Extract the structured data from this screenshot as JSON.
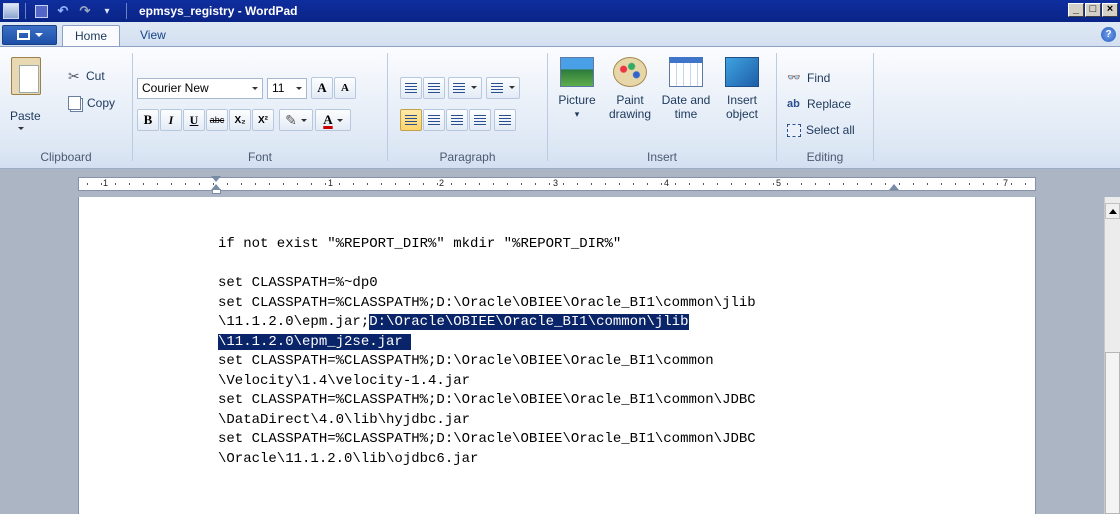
{
  "window": {
    "title": "epmsys_registry - WordPad"
  },
  "tabs": [
    {
      "label": "Home"
    },
    {
      "label": "View"
    }
  ],
  "ribbon": {
    "clipboard": {
      "group_label": "Clipboard",
      "paste": "Paste",
      "cut": "Cut",
      "copy": "Copy"
    },
    "font": {
      "group_label": "Font",
      "family": "Courier New",
      "size": "11",
      "grow": "A",
      "shrink": "A",
      "bold": "B",
      "italic": "I",
      "underline": "U",
      "strike": "abc",
      "subscript": "X₂",
      "superscript": "X²"
    },
    "paragraph": {
      "group_label": "Paragraph"
    },
    "insert": {
      "group_label": "Insert",
      "picture": "Picture",
      "paint_line1": "Paint",
      "paint_line2": "drawing",
      "datetime_line1": "Date and",
      "datetime_line2": "time",
      "object_line1": "Insert",
      "object_line2": "object"
    },
    "editing": {
      "group_label": "Editing",
      "find": "Find",
      "replace": "Replace",
      "select_all": "Select all"
    }
  },
  "ruler": {
    "numbers": [
      "1",
      "1",
      "2",
      "3",
      "4",
      "5",
      "7"
    ]
  },
  "document": {
    "lines": [
      "if not exist \"%REPORT_DIR%\" mkdir \"%REPORT_DIR%\"",
      "",
      "set CLASSPATH=%~dp0",
      "set CLASSPATH=%CLASSPATH%;D:\\Oracle\\OBIEE\\Oracle_BI1\\common\\jlib",
      "\\11.1.2.0\\epm.jar;",
      "D:\\Oracle\\OBIEE\\Oracle_BI1\\common\\jlib",
      "\\11.1.2.0\\epm_j2se.jar ",
      "set CLASSPATH=%CLASSPATH%;D:\\Oracle\\OBIEE\\Oracle_BI1\\common",
      "\\Velocity\\1.4\\velocity-1.4.jar",
      "set CLASSPATH=%CLASSPATH%;D:\\Oracle\\OBIEE\\Oracle_BI1\\common\\JDBC",
      "\\DataDirect\\4.0\\lib\\hyjdbc.jar",
      "set CLASSPATH=%CLASSPATH%;D:\\Oracle\\OBIEE\\Oracle_BI1\\common\\JDBC",
      "\\Oracle\\11.1.2.0\\lib\\ojdbc6.jar"
    ]
  }
}
